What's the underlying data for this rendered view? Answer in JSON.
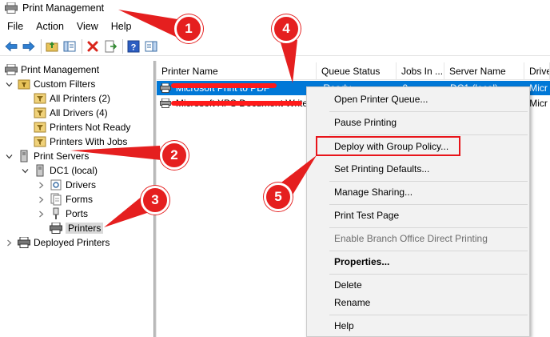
{
  "window": {
    "title": "Print Management"
  },
  "menu": [
    "File",
    "Action",
    "View",
    "Help"
  ],
  "toolbar": [
    "back-arrow-icon",
    "forward-arrow-icon",
    "up-folder-icon",
    "show-hide-tree-icon",
    "delete-icon",
    "export-icon",
    "help-icon",
    "properties-pane-icon"
  ],
  "tree": {
    "items": [
      {
        "label": "Print Management",
        "level": 0,
        "expand": "",
        "icon": "print-management-icon"
      },
      {
        "label": "Custom Filters",
        "level": 1,
        "expand": "open",
        "icon": "filter-folder-icon"
      },
      {
        "label": "All Printers (2)",
        "level": 2,
        "expand": "",
        "icon": "filter-icon"
      },
      {
        "label": "All Drivers (4)",
        "level": 2,
        "expand": "",
        "icon": "filter-icon"
      },
      {
        "label": "Printers Not Ready",
        "level": 2,
        "expand": "",
        "icon": "filter-icon"
      },
      {
        "label": "Printers With Jobs",
        "level": 2,
        "expand": "",
        "icon": "filter-icon"
      },
      {
        "label": "Print Servers",
        "level": 1,
        "expand": "open",
        "icon": "server-tower-icon"
      },
      {
        "label": "DC1 (local)",
        "level": 2,
        "expand": "open",
        "icon": "server-tower-icon"
      },
      {
        "label": "Drivers",
        "level": 3,
        "expand": "closed",
        "icon": "drivers-icon"
      },
      {
        "label": "Forms",
        "level": 3,
        "expand": "closed",
        "icon": "forms-icon"
      },
      {
        "label": "Ports",
        "level": 3,
        "expand": "closed",
        "icon": "ports-icon"
      },
      {
        "label": "Printers",
        "level": 3,
        "expand": "",
        "icon": "printer-icon",
        "selected": true
      },
      {
        "label": "Deployed Printers",
        "level": 1,
        "expand": "closed",
        "icon": "printer-icon"
      }
    ]
  },
  "list": {
    "columns": [
      "Printer Name",
      "Queue Status",
      "Jobs In ...",
      "Server Name",
      "Drive"
    ],
    "rows": [
      {
        "name": "Microsoft Print to PDF",
        "status": "Ready",
        "jobs": "0",
        "server": "DC1 (local)",
        "driver": "Micr",
        "selected": true
      },
      {
        "name": "Microsoft XPS Document Writer",
        "status": "",
        "jobs": "",
        "server": "",
        "driver": "Micr",
        "selected": false
      }
    ]
  },
  "context_menu": {
    "items": [
      {
        "label": "Open Printer Queue...",
        "style": "normal"
      },
      {
        "label": "Pause Printing",
        "style": "normal"
      },
      {
        "label": "Deploy with Group Policy...",
        "style": "highlighted"
      },
      {
        "label": "Set Printing Defaults...",
        "style": "normal"
      },
      {
        "label": "Manage Sharing...",
        "style": "normal"
      },
      {
        "label": "Print Test Page",
        "style": "normal"
      },
      {
        "label": "Enable Branch Office Direct Printing",
        "style": "disabled"
      },
      {
        "label": "Properties...",
        "style": "bold"
      },
      {
        "label": "Delete",
        "style": "normal"
      },
      {
        "label": "Rename",
        "style": "normal"
      },
      {
        "label": "Help",
        "style": "normal"
      }
    ]
  },
  "callouts": [
    "1",
    "2",
    "3",
    "4",
    "5"
  ],
  "colors": {
    "accent": "#0078d7",
    "callout": "#e51f1f"
  }
}
